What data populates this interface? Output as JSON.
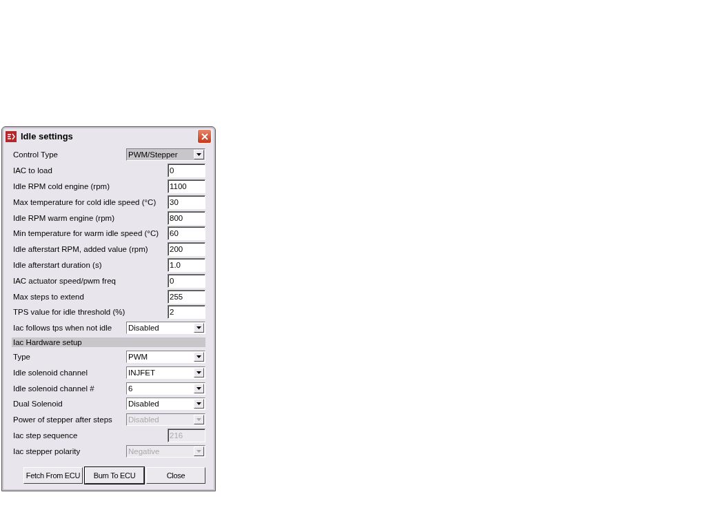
{
  "window": {
    "title": "Idle settings"
  },
  "fields": [
    {
      "kind": "select",
      "label": "Control Type",
      "value": "PWM/Stepper",
      "highlighted": true,
      "disabled": false
    },
    {
      "kind": "number",
      "label": "IAC to load",
      "value": "0",
      "disabled": false
    },
    {
      "kind": "number",
      "label": "Idle RPM cold engine (rpm)",
      "value": "1100",
      "disabled": false
    },
    {
      "kind": "number",
      "label": "Max temperature for cold idle speed (°C)",
      "value": "30",
      "disabled": false
    },
    {
      "kind": "number",
      "label": "Idle RPM warm engine (rpm)",
      "value": "800",
      "disabled": false
    },
    {
      "kind": "number",
      "label": "Min temperature for warm idle speed (°C)",
      "value": "60",
      "disabled": false
    },
    {
      "kind": "number",
      "label": "Idle afterstart RPM, added value (rpm)",
      "value": "200",
      "disabled": false
    },
    {
      "kind": "number",
      "label": "Idle afterstart duration (s)",
      "value": "1.0",
      "disabled": false
    },
    {
      "kind": "number",
      "label": "IAC actuator speed/pwm freq",
      "value": "0",
      "disabled": false
    },
    {
      "kind": "number",
      "label": "Max steps to extend",
      "value": "255",
      "disabled": false
    },
    {
      "kind": "number",
      "label": "TPS value for idle threshold (%)",
      "value": "2",
      "disabled": false
    },
    {
      "kind": "select",
      "label": "Iac follows tps when not idle",
      "value": "Disabled",
      "highlighted": false,
      "disabled": false
    },
    {
      "kind": "section",
      "label": "Iac Hardware setup"
    },
    {
      "kind": "select",
      "label": "Type",
      "value": "PWM",
      "highlighted": false,
      "disabled": false
    },
    {
      "kind": "select",
      "label": "Idle solenoid channel",
      "value": "INJFET",
      "highlighted": false,
      "disabled": false
    },
    {
      "kind": "select",
      "label": "Idle solenoid channel #",
      "value": "6",
      "highlighted": false,
      "disabled": false
    },
    {
      "kind": "select",
      "label": "Dual Solenoid",
      "value": "Disabled",
      "highlighted": false,
      "disabled": false
    },
    {
      "kind": "select",
      "label": "Power of stepper after steps",
      "value": "Disabled",
      "highlighted": false,
      "disabled": true
    },
    {
      "kind": "number",
      "label": "Iac step sequence",
      "value": "216",
      "disabled": true
    },
    {
      "kind": "select",
      "label": "Iac stepper polarity",
      "value": "Negative",
      "highlighted": false,
      "disabled": true
    }
  ],
  "buttons": [
    {
      "label": "Fetch From ECU",
      "default": false
    },
    {
      "label": "Burn To ECU",
      "default": true
    },
    {
      "label": "Close",
      "default": false
    }
  ]
}
